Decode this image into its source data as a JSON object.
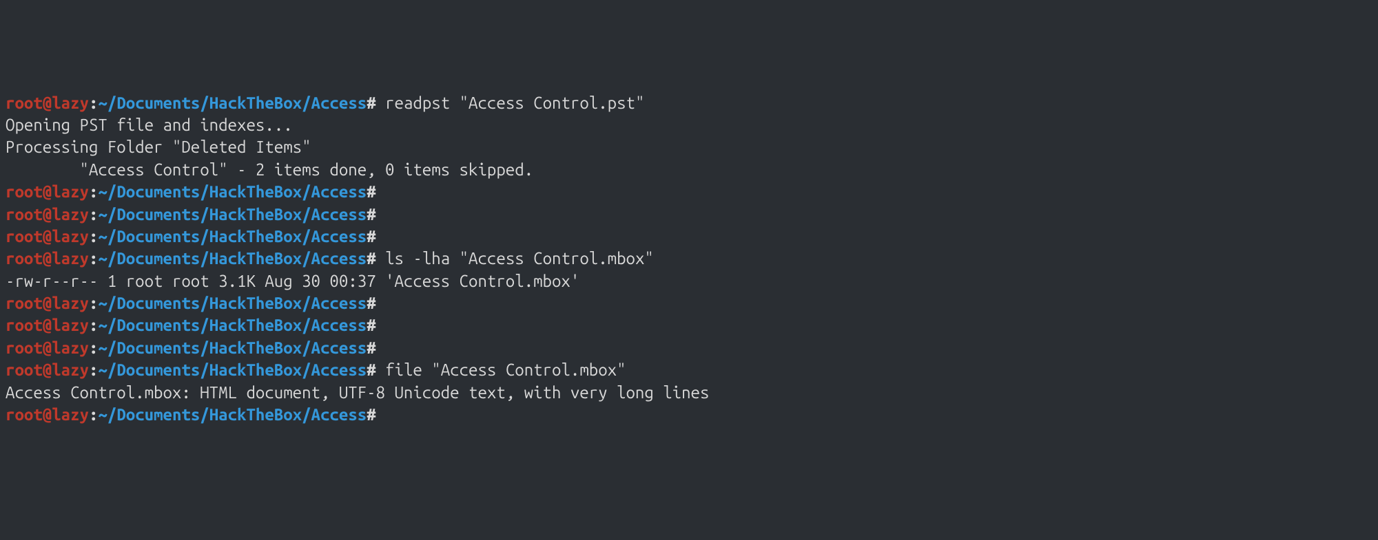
{
  "prompt": {
    "user": "root",
    "at": "@",
    "host": "lazy",
    "colon": ":",
    "path": "~/Documents/HackTheBox/Access",
    "hash": "#"
  },
  "lines": [
    {
      "type": "cmd",
      "text": " readpst \"Access Control.pst\""
    },
    {
      "type": "out",
      "text": "Opening PST file and indexes..."
    },
    {
      "type": "out",
      "text": "Processing Folder \"Deleted Items\""
    },
    {
      "type": "out",
      "text": "        \"Access Control\" - 2 items done, 0 items skipped."
    },
    {
      "type": "cmd",
      "text": ""
    },
    {
      "type": "cmd",
      "text": ""
    },
    {
      "type": "cmd",
      "text": ""
    },
    {
      "type": "cmd",
      "text": " ls -lha \"Access Control.mbox\""
    },
    {
      "type": "out",
      "text": "-rw-r--r-- 1 root root 3.1K Aug 30 00:37 'Access Control.mbox'"
    },
    {
      "type": "cmd",
      "text": ""
    },
    {
      "type": "cmd",
      "text": ""
    },
    {
      "type": "cmd",
      "text": ""
    },
    {
      "type": "cmd",
      "text": " file \"Access Control.mbox\""
    },
    {
      "type": "out",
      "text": "Access Control.mbox: HTML document, UTF-8 Unicode text, with very long lines"
    },
    {
      "type": "cmd",
      "text": ""
    }
  ]
}
